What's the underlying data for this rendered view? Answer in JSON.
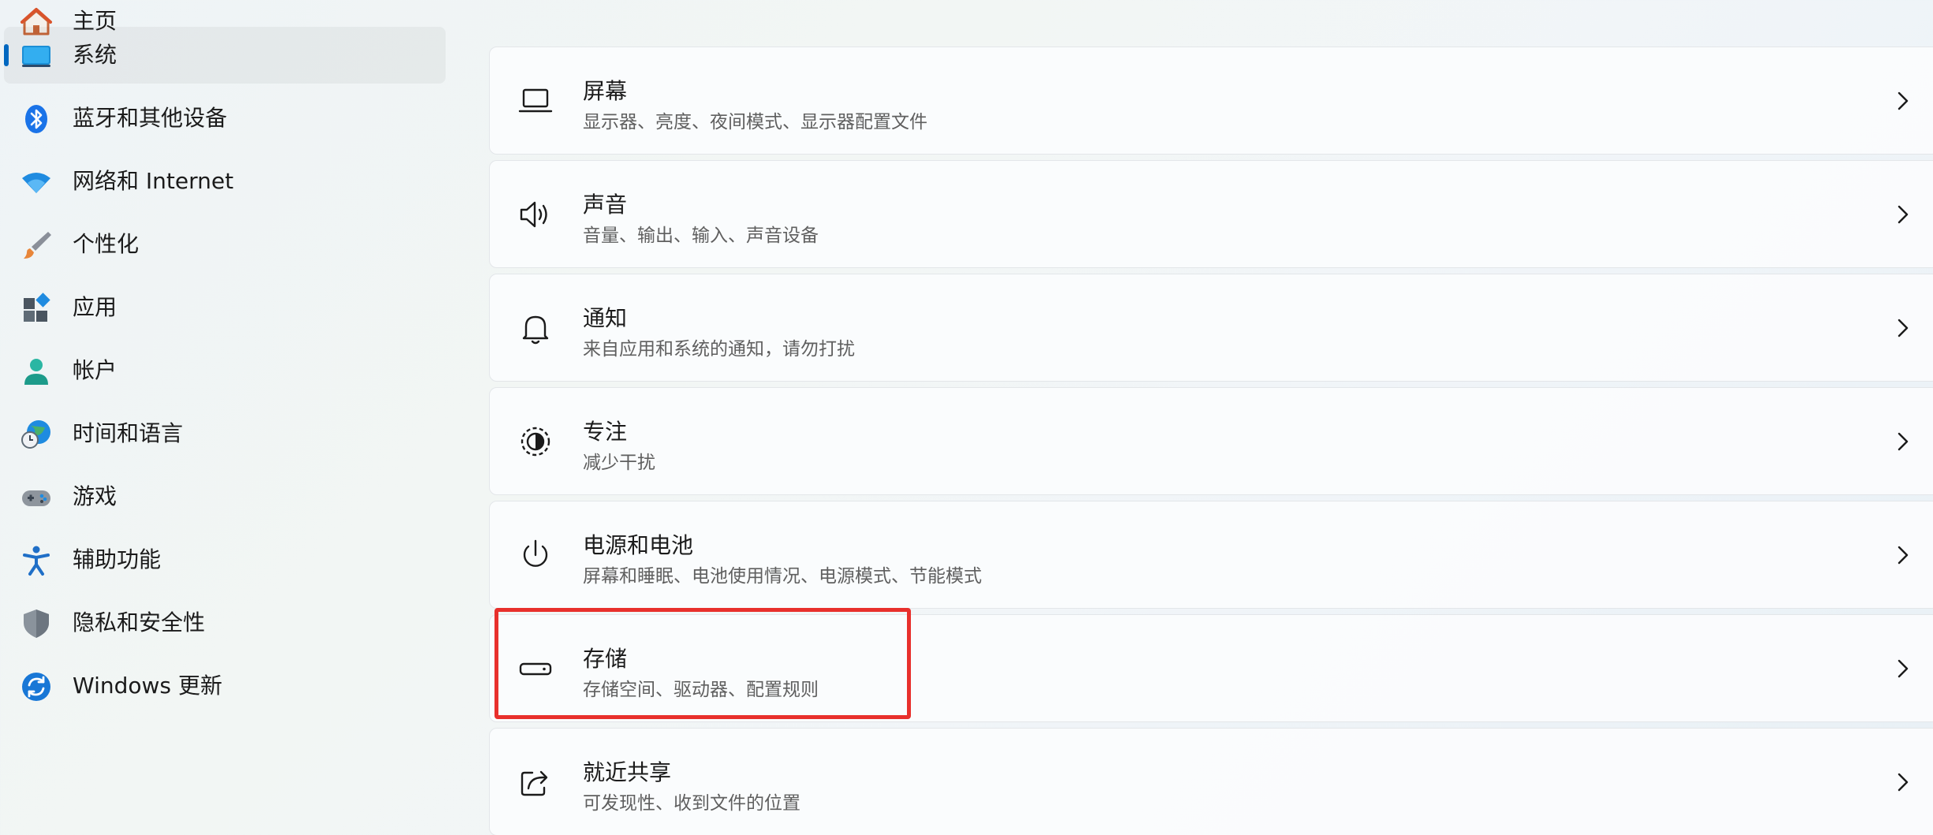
{
  "sidebar": {
    "items": [
      {
        "label": "主页",
        "icon": "home-icon"
      },
      {
        "label": "系统",
        "icon": "system-display-icon",
        "selected": true
      },
      {
        "label": "蓝牙和其他设备",
        "icon": "bluetooth-icon"
      },
      {
        "label": "网络和 Internet",
        "icon": "wifi-icon"
      },
      {
        "label": "个性化",
        "icon": "paintbrush-icon"
      },
      {
        "label": "应用",
        "icon": "apps-icon"
      },
      {
        "label": "帐户",
        "icon": "account-icon"
      },
      {
        "label": "时间和语言",
        "icon": "time-language-icon"
      },
      {
        "label": "游戏",
        "icon": "gamepad-icon"
      },
      {
        "label": "辅助功能",
        "icon": "accessibility-icon"
      },
      {
        "label": "隐私和安全性",
        "icon": "shield-icon"
      },
      {
        "label": "Windows 更新",
        "icon": "update-icon"
      }
    ]
  },
  "main": {
    "cards": [
      {
        "title": "屏幕",
        "subtitle": "显示器、亮度、夜间模式、显示器配置文件",
        "icon": "laptop-icon"
      },
      {
        "title": "声音",
        "subtitle": "音量、输出、输入、声音设备",
        "icon": "speaker-icon"
      },
      {
        "title": "通知",
        "subtitle": "来自应用和系统的通知，请勿打扰",
        "icon": "bell-icon"
      },
      {
        "title": "专注",
        "subtitle": "减少干扰",
        "icon": "focus-icon"
      },
      {
        "title": "电源和电池",
        "subtitle": "屏幕和睡眠、电池使用情况、电源模式、节能模式",
        "icon": "power-icon"
      },
      {
        "title": "存储",
        "subtitle": "存储空间、驱动器、配置规则",
        "icon": "storage-drive-icon",
        "highlighted": true
      },
      {
        "title": "就近共享",
        "subtitle": "可发现性、收到文件的位置",
        "icon": "share-icon"
      }
    ]
  },
  "colors": {
    "accent": "#0067c0",
    "highlight_border": "#e8302c"
  }
}
